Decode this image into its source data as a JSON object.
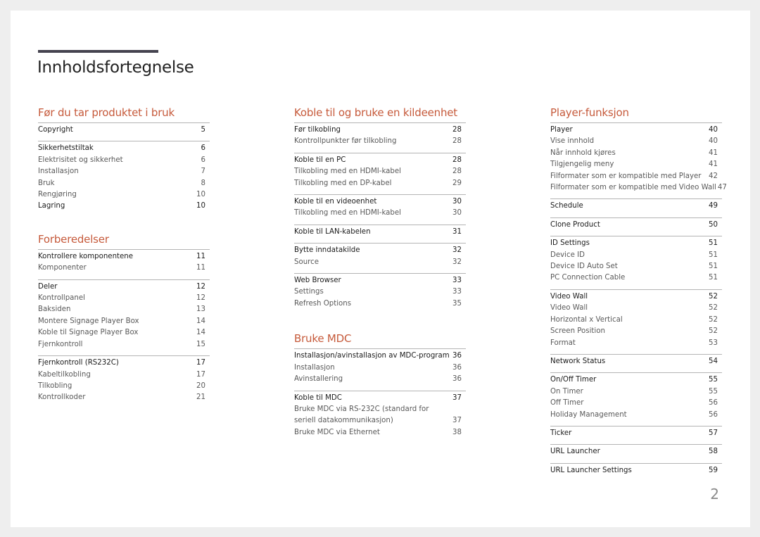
{
  "page_title": "Innholdsfortegnelse",
  "page_number": "2",
  "colors": {
    "chapter_accent": "#c65a3b",
    "title_bar": "#45434f"
  },
  "columns": [
    {
      "chapters": [
        {
          "title": "Før du tar produktet i bruk",
          "groups": [
            {
              "entries": [
                {
                  "label": "Copyright",
                  "page": "5",
                  "section": true
                }
              ]
            },
            {
              "entries": [
                {
                  "label": "Sikkerhetstiltak",
                  "page": "6",
                  "section": true
                },
                {
                  "label": "Elektrisitet og sikkerhet",
                  "page": "6",
                  "section": false
                },
                {
                  "label": "Installasjon",
                  "page": "7",
                  "section": false
                },
                {
                  "label": "Bruk",
                  "page": "8",
                  "section": false
                },
                {
                  "label": "Rengjøring",
                  "page": "10",
                  "section": false
                },
                {
                  "label": "Lagring",
                  "page": "10",
                  "section": true
                }
              ]
            }
          ]
        },
        {
          "title": "Forberedelser",
          "groups": [
            {
              "entries": [
                {
                  "label": "Kontrollere komponentene",
                  "page": "11",
                  "section": true
                },
                {
                  "label": "Komponenter",
                  "page": "11",
                  "section": false
                }
              ]
            },
            {
              "entries": [
                {
                  "label": "Deler",
                  "page": "12",
                  "section": true
                },
                {
                  "label": "Kontrollpanel",
                  "page": "12",
                  "section": false
                },
                {
                  "label": "Baksiden",
                  "page": "13",
                  "section": false
                },
                {
                  "label": "Montere Signage Player Box",
                  "page": "14",
                  "section": false
                },
                {
                  "label": "Koble til Signage Player Box",
                  "page": "14",
                  "section": false
                },
                {
                  "label": "Fjernkontroll",
                  "page": "15",
                  "section": false
                }
              ]
            },
            {
              "entries": [
                {
                  "label": "Fjernkontroll (RS232C)",
                  "page": "17",
                  "section": true
                },
                {
                  "label": "Kabeltilkobling",
                  "page": "17",
                  "section": false
                },
                {
                  "label": "Tilkobling",
                  "page": "20",
                  "section": false
                },
                {
                  "label": "Kontrollkoder",
                  "page": "21",
                  "section": false
                }
              ]
            }
          ]
        }
      ]
    },
    {
      "chapters": [
        {
          "title": "Koble til og bruke en kildeenhet",
          "groups": [
            {
              "entries": [
                {
                  "label": "Før tilkobling",
                  "page": "28",
                  "section": true
                },
                {
                  "label": "Kontrollpunkter før tilkobling",
                  "page": "28",
                  "section": false
                }
              ]
            },
            {
              "entries": [
                {
                  "label": "Koble til en PC",
                  "page": "28",
                  "section": true
                },
                {
                  "label": "Tilkobling med en HDMI-kabel",
                  "page": "28",
                  "section": false
                },
                {
                  "label": "Tilkobling med en DP-kabel",
                  "page": "29",
                  "section": false
                }
              ]
            },
            {
              "entries": [
                {
                  "label": "Koble til en videoenhet",
                  "page": "30",
                  "section": true
                },
                {
                  "label": "Tilkobling med en HDMI-kabel",
                  "page": "30",
                  "section": false
                }
              ]
            },
            {
              "entries": [
                {
                  "label": "Koble til LAN-kabelen",
                  "page": "31",
                  "section": true
                }
              ]
            },
            {
              "entries": [
                {
                  "label": "Bytte inndatakilde",
                  "page": "32",
                  "section": true
                },
                {
                  "label": "Source",
                  "page": "32",
                  "section": false
                }
              ]
            },
            {
              "entries": [
                {
                  "label": "Web Browser",
                  "page": "33",
                  "section": true
                },
                {
                  "label": "Settings",
                  "page": "33",
                  "section": false
                },
                {
                  "label": "Refresh Options",
                  "page": "35",
                  "section": false
                }
              ]
            }
          ]
        },
        {
          "title": "Bruke MDC",
          "groups": [
            {
              "entries": [
                {
                  "label": "Installasjon/avinstallasjon av MDC-program",
                  "page": "36",
                  "section": true
                },
                {
                  "label": "Installasjon",
                  "page": "36",
                  "section": false
                },
                {
                  "label": "Avinstallering",
                  "page": "36",
                  "section": false
                }
              ]
            },
            {
              "entries": [
                {
                  "label": "Koble til MDC",
                  "page": "37",
                  "section": true
                },
                {
                  "label": "Bruke MDC via RS-232C (standard for seriell datakommunikasjon)",
                  "page": "37",
                  "section": false,
                  "wrap": true
                },
                {
                  "label": "Bruke MDC via Ethernet",
                  "page": "38",
                  "section": false
                }
              ]
            }
          ]
        }
      ]
    },
    {
      "chapters": [
        {
          "title": "Player-funksjon",
          "groups": [
            {
              "entries": [
                {
                  "label": "Player",
                  "page": "40",
                  "section": true
                },
                {
                  "label": "Vise innhold",
                  "page": "40",
                  "section": false
                },
                {
                  "label": "Når innhold kjøres",
                  "page": "41",
                  "section": false
                },
                {
                  "label": "Tilgjengelig meny",
                  "page": "41",
                  "section": false
                },
                {
                  "label": "Filformater som er kompatible med Player",
                  "page": "42",
                  "section": false
                },
                {
                  "label": "Filformater som er kompatible med Video Wall",
                  "page": "47",
                  "section": false
                }
              ]
            },
            {
              "entries": [
                {
                  "label": "Schedule",
                  "page": "49",
                  "section": true
                }
              ]
            },
            {
              "entries": [
                {
                  "label": "Clone Product",
                  "page": "50",
                  "section": true
                }
              ]
            },
            {
              "entries": [
                {
                  "label": "ID Settings",
                  "page": "51",
                  "section": true
                },
                {
                  "label": "Device ID",
                  "page": "51",
                  "section": false
                },
                {
                  "label": "Device ID Auto Set",
                  "page": "51",
                  "section": false
                },
                {
                  "label": "PC Connection Cable",
                  "page": "51",
                  "section": false
                }
              ]
            },
            {
              "entries": [
                {
                  "label": "Video Wall",
                  "page": "52",
                  "section": true
                },
                {
                  "label": "Video Wall",
                  "page": "52",
                  "section": false
                },
                {
                  "label": "Horizontal x Vertical",
                  "page": "52",
                  "section": false
                },
                {
                  "label": "Screen Position",
                  "page": "52",
                  "section": false
                },
                {
                  "label": "Format",
                  "page": "53",
                  "section": false
                }
              ]
            },
            {
              "entries": [
                {
                  "label": "Network Status",
                  "page": "54",
                  "section": true
                }
              ]
            },
            {
              "entries": [
                {
                  "label": "On/Off Timer",
                  "page": "55",
                  "section": true
                },
                {
                  "label": "On Timer",
                  "page": "55",
                  "section": false
                },
                {
                  "label": "Off Timer",
                  "page": "56",
                  "section": false
                },
                {
                  "label": "Holiday Management",
                  "page": "56",
                  "section": false
                }
              ]
            },
            {
              "entries": [
                {
                  "label": "Ticker",
                  "page": "57",
                  "section": true
                }
              ]
            },
            {
              "entries": [
                {
                  "label": "URL Launcher",
                  "page": "58",
                  "section": true
                }
              ]
            },
            {
              "entries": [
                {
                  "label": "URL Launcher Settings",
                  "page": "59",
                  "section": true
                }
              ]
            }
          ]
        }
      ]
    }
  ]
}
